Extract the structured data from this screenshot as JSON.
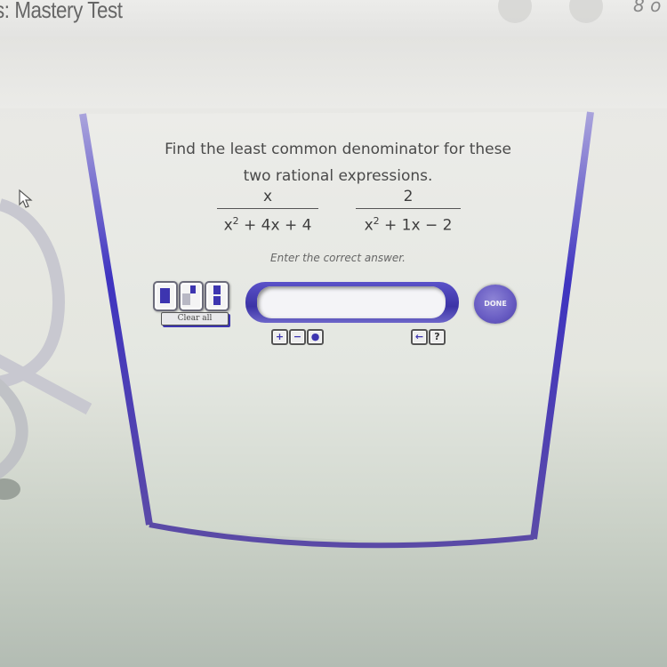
{
  "header": {
    "title": "s: Mastery Test",
    "page_indicator": "8 o"
  },
  "question": {
    "prompt_line1": "Find the least common denominator for these",
    "prompt_line2": "two rational expressions.",
    "expressions": [
      {
        "numerator": "x",
        "denominator_base": "x",
        "denominator_exp": "2",
        "denominator_rest": " + 4x + 4"
      },
      {
        "numerator": "2",
        "denominator_base": "x",
        "denominator_exp": "2",
        "denominator_rest": " + 1x − 2"
      }
    ],
    "instruction": "Enter the correct answer."
  },
  "answer": {
    "value": "",
    "placeholder": ""
  },
  "toolbar": {
    "template_buttons": [
      {
        "name": "box-template"
      },
      {
        "name": "exponent-template"
      },
      {
        "name": "fraction-template"
      }
    ],
    "clear_all_label": "Clear all",
    "done_label": "DONE",
    "sign_buttons": [
      {
        "name": "plus",
        "glyph": "+"
      },
      {
        "name": "minus",
        "glyph": "−"
      },
      {
        "name": "dot",
        "glyph": "●"
      }
    ],
    "backspace_glyph": "←",
    "help_glyph": "?"
  },
  "colors": {
    "accent": "#3d35b0",
    "frame": "#4a3fb8",
    "done": "#6a5ec4"
  }
}
